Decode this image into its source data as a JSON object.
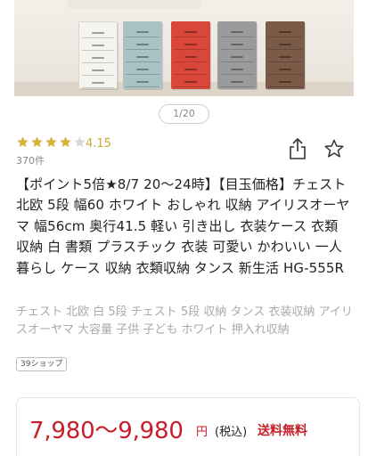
{
  "gallery": {
    "pager": "1/20",
    "chest_colors": [
      "#f5f3ee",
      "#a9c3c4",
      "#d9473a",
      "#9a9b9c",
      "#7b5a48"
    ]
  },
  "rating": {
    "stars": 4,
    "value": "4.15",
    "review_count": "370件",
    "star_color": "#d9b23b"
  },
  "actions": {
    "share_icon": "share-icon",
    "favorite_icon": "star-outline-icon"
  },
  "product": {
    "title": "【ポイント5倍★8/7 20～24時】【目玉価格】チェスト 北欧 5段 幅60 ホワイト おしゃれ 収納 アイリスオーヤマ 幅56cm 奥行41.5 軽い 引き出し 衣装ケース 衣類 収納 白 書類 プラスチック 衣装 可愛い かわいい 一人暮らし ケース 収納 衣類収納 タンス 新生活 HG-555R",
    "subtitle": "チェスト 北欧 白 5段 チェスト 5段 収納 タンス 衣装収納 アイリスオーヤマ 大容量 子供 子ども ホワイト 押入れ収納",
    "shop_badge": "39ショップ"
  },
  "price": {
    "range": "7,980～9,980",
    "yen": "円",
    "tax": "(税込)",
    "shipping": "送料無料",
    "accent_color": "#c81e2a"
  }
}
